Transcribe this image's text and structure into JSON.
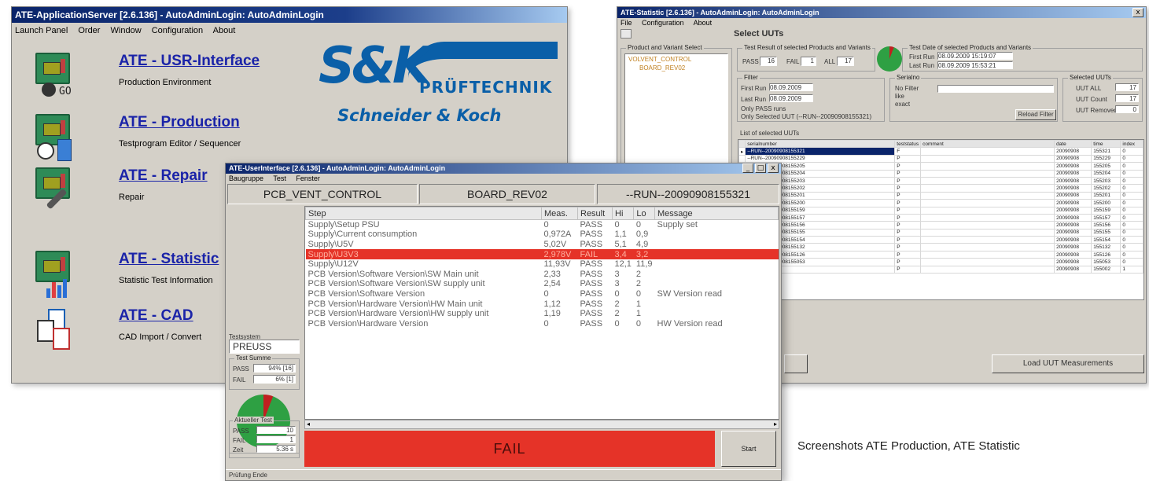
{
  "app": {
    "title": "ATE-ApplicationServer  [2.6.136]  - AutoAdminLogin: AutoAdminLogin",
    "menu": [
      "Launch Panel",
      "Order",
      "Window",
      "Configuration",
      "About"
    ],
    "items": [
      {
        "label": "ATE - USR-Interface",
        "sub": "Production Environment",
        "icon": "usr-interface-icon",
        "badge": "GO"
      },
      {
        "label": "ATE - Production",
        "sub": "Testprogram Editor / Sequencer",
        "icon": "production-icon"
      },
      {
        "label": "ATE - Repair",
        "sub": "Repair",
        "icon": "repair-icon"
      },
      {
        "label": "ATE - Statistic",
        "sub": "Statistic Test Information",
        "icon": "statistic-icon"
      },
      {
        "label": "ATE - CAD",
        "sub": "CAD Import / Convert",
        "icon": "cad-icon"
      }
    ],
    "logo": {
      "mark": "S&K",
      "tagline": "PRÜFTECHNIK",
      "name": "Schneider & Koch",
      "color": "#0a5fa8"
    }
  },
  "stat": {
    "title": "ATE-Statistic  [2.6.136]  - AutoAdminLogin: AutoAdminLogin",
    "menu": [
      "File",
      "Configuration",
      "About"
    ],
    "heading": "Select UUTs",
    "product_group": "Product and Variant Select",
    "tree": [
      "VOLVENT_CONTROL",
      "BOARD_REV02"
    ],
    "result_group": "Test Result of selected Products and Variants",
    "pass_label": "PASS",
    "pass_value": "16",
    "fail_label": "FAIL",
    "fail_value": "1",
    "all_label": "ALL",
    "all_value": "17",
    "date_group": "Test Date of selected Products and Variants",
    "first_run_label": "First Run",
    "first_run_value": "08.09.2009  15:19:07",
    "last_run_label": "Last Run",
    "last_run_value": "08.09.2009  15:53:21",
    "filter_label": "Filter",
    "filter_first_run": "First Run",
    "filter_first_value": "08.09.2009",
    "filter_last_run": "Last Run",
    "filter_last_value": "08.09.2009",
    "only_pass": "Only PASS runs",
    "only_selected": "Only Selected UUT (--RUN--20090908155321)",
    "serial_group": "Serialno",
    "serial_opts": [
      "No Filter",
      "like",
      "exact"
    ],
    "reload_filter": "Reload Filter",
    "selected_group": "Selected UUTs",
    "uut_all_label": "UUT ALL",
    "uut_all_value": "17",
    "uut_count_label": "UUT Count",
    "uut_count_value": "17",
    "uut_removed_label": "UUT Removed",
    "uut_removed_value": "0",
    "list_group": "List of selected UUTs",
    "columns": [
      "serialnumber",
      "teststatus",
      "comment",
      "date",
      "time",
      "index"
    ],
    "rows": [
      [
        "--RUN--20090908155321",
        "F",
        "",
        "20090908",
        "155321",
        "0"
      ],
      [
        "--RUN--20090908155229",
        "P",
        "",
        "20090908",
        "155229",
        "0"
      ],
      [
        "--RUN--20090908155205",
        "P",
        "",
        "20090908",
        "155205",
        "0"
      ],
      [
        "--RUN--20090908155204",
        "P",
        "",
        "20090908",
        "155204",
        "0"
      ],
      [
        "--RUN--20090908155203",
        "P",
        "",
        "20090908",
        "155203",
        "0"
      ],
      [
        "--RUN--20090908155202",
        "P",
        "",
        "20090908",
        "155202",
        "0"
      ],
      [
        "--RUN--20090908155201",
        "P",
        "",
        "20090908",
        "155201",
        "0"
      ],
      [
        "--RUN--20090908155200",
        "P",
        "",
        "20090908",
        "155200",
        "0"
      ],
      [
        "--RUN--20090908155159",
        "P",
        "",
        "20090908",
        "155159",
        "0"
      ],
      [
        "--RUN--20090908155157",
        "P",
        "",
        "20090908",
        "155157",
        "0"
      ],
      [
        "--RUN--20090908155156",
        "P",
        "",
        "20090908",
        "155156",
        "0"
      ],
      [
        "--RUN--20090908155155",
        "P",
        "",
        "20090908",
        "155155",
        "0"
      ],
      [
        "--RUN--20090908155154",
        "P",
        "",
        "20090908",
        "155154",
        "0"
      ],
      [
        "--RUN--20090908155132",
        "P",
        "",
        "20090908",
        "155132",
        "0"
      ],
      [
        "--RUN--20090908155126",
        "P",
        "",
        "20090908",
        "155126",
        "0"
      ],
      [
        "--RUN--20090908155053",
        "P",
        "",
        "20090908",
        "155053",
        "0"
      ],
      [
        "--",
        "P",
        "",
        "20090908",
        "155002",
        "1"
      ]
    ],
    "load_button": "Load UUT Measurements"
  },
  "ui": {
    "title": "ATE-UserInterface  [2.6.136]  - AutoAdminLogin: AutoAdminLogin",
    "menu": [
      "Baugruppe",
      "Test",
      "Fenster"
    ],
    "product": "PCB_VENT_CONTROL",
    "variant": "BOARD_REV02",
    "run": "--RUN--20090908155321",
    "columns": [
      "Step",
      "Meas.",
      "Result",
      "Hi",
      "Lo",
      "Message"
    ],
    "steps": [
      {
        "step": "Supply\\Setup PSU",
        "meas": "0",
        "result": "PASS",
        "hi": "0",
        "lo": "0",
        "msg": "Supply set"
      },
      {
        "step": "Supply\\Current consumption",
        "meas": "0,972A",
        "result": "PASS",
        "hi": "1,1",
        "lo": "0,9",
        "msg": ""
      },
      {
        "step": "Supply\\U5V",
        "meas": "5,02V",
        "result": "PASS",
        "hi": "5,1",
        "lo": "4,9",
        "msg": ""
      },
      {
        "step": "Supply\\U3V3",
        "meas": "2,978V",
        "result": "FAIL",
        "hi": "3,4",
        "lo": "3,2",
        "msg": ""
      },
      {
        "step": "Supply\\U12V",
        "meas": "11,93V",
        "result": "PASS",
        "hi": "12,1",
        "lo": "11,9",
        "msg": ""
      },
      {
        "step": "PCB Version\\Software Version\\SW Main unit",
        "meas": "2,33",
        "result": "PASS",
        "hi": "3",
        "lo": "2",
        "msg": ""
      },
      {
        "step": "PCB Version\\Software Version\\SW supply unit",
        "meas": "2,54",
        "result": "PASS",
        "hi": "3",
        "lo": "2",
        "msg": ""
      },
      {
        "step": "PCB Version\\Software Version",
        "meas": "0",
        "result": "PASS",
        "hi": "0",
        "lo": "0",
        "msg": "SW Version read"
      },
      {
        "step": "PCB Version\\Hardware Version\\HW Main unit",
        "meas": "1,12",
        "result": "PASS",
        "hi": "2",
        "lo": "1",
        "msg": ""
      },
      {
        "step": "PCB Version\\Hardware Version\\HW supply unit",
        "meas": "1,19",
        "result": "PASS",
        "hi": "2",
        "lo": "1",
        "msg": ""
      },
      {
        "step": "PCB Version\\Hardware Version",
        "meas": "0",
        "result": "PASS",
        "hi": "0",
        "lo": "0",
        "msg": "HW Version read"
      }
    ],
    "testsystem_label": "Testsystem",
    "testsystem_value": "PREUSS",
    "sum_group": "Test Summe",
    "sum_pass_label": "PASS",
    "sum_pass_value": "94% [16]",
    "sum_fail_label": "FAIL",
    "sum_fail_value": "6% [1]",
    "current_group": "Aktueller Test",
    "cur_pass_label": "PASS",
    "cur_pass_value": "10",
    "cur_fail_label": "FAIL",
    "cur_fail_value": "1",
    "cur_time_label": "Zeit",
    "cur_time_value": "5.36 s",
    "result_text": "FAIL",
    "start_button": "Start",
    "status": "Prüfung Ende",
    "fail_color": "#e53328",
    "pass_color": "#2ea043"
  },
  "caption": "Screenshots ATE Production, ATE Statistic"
}
